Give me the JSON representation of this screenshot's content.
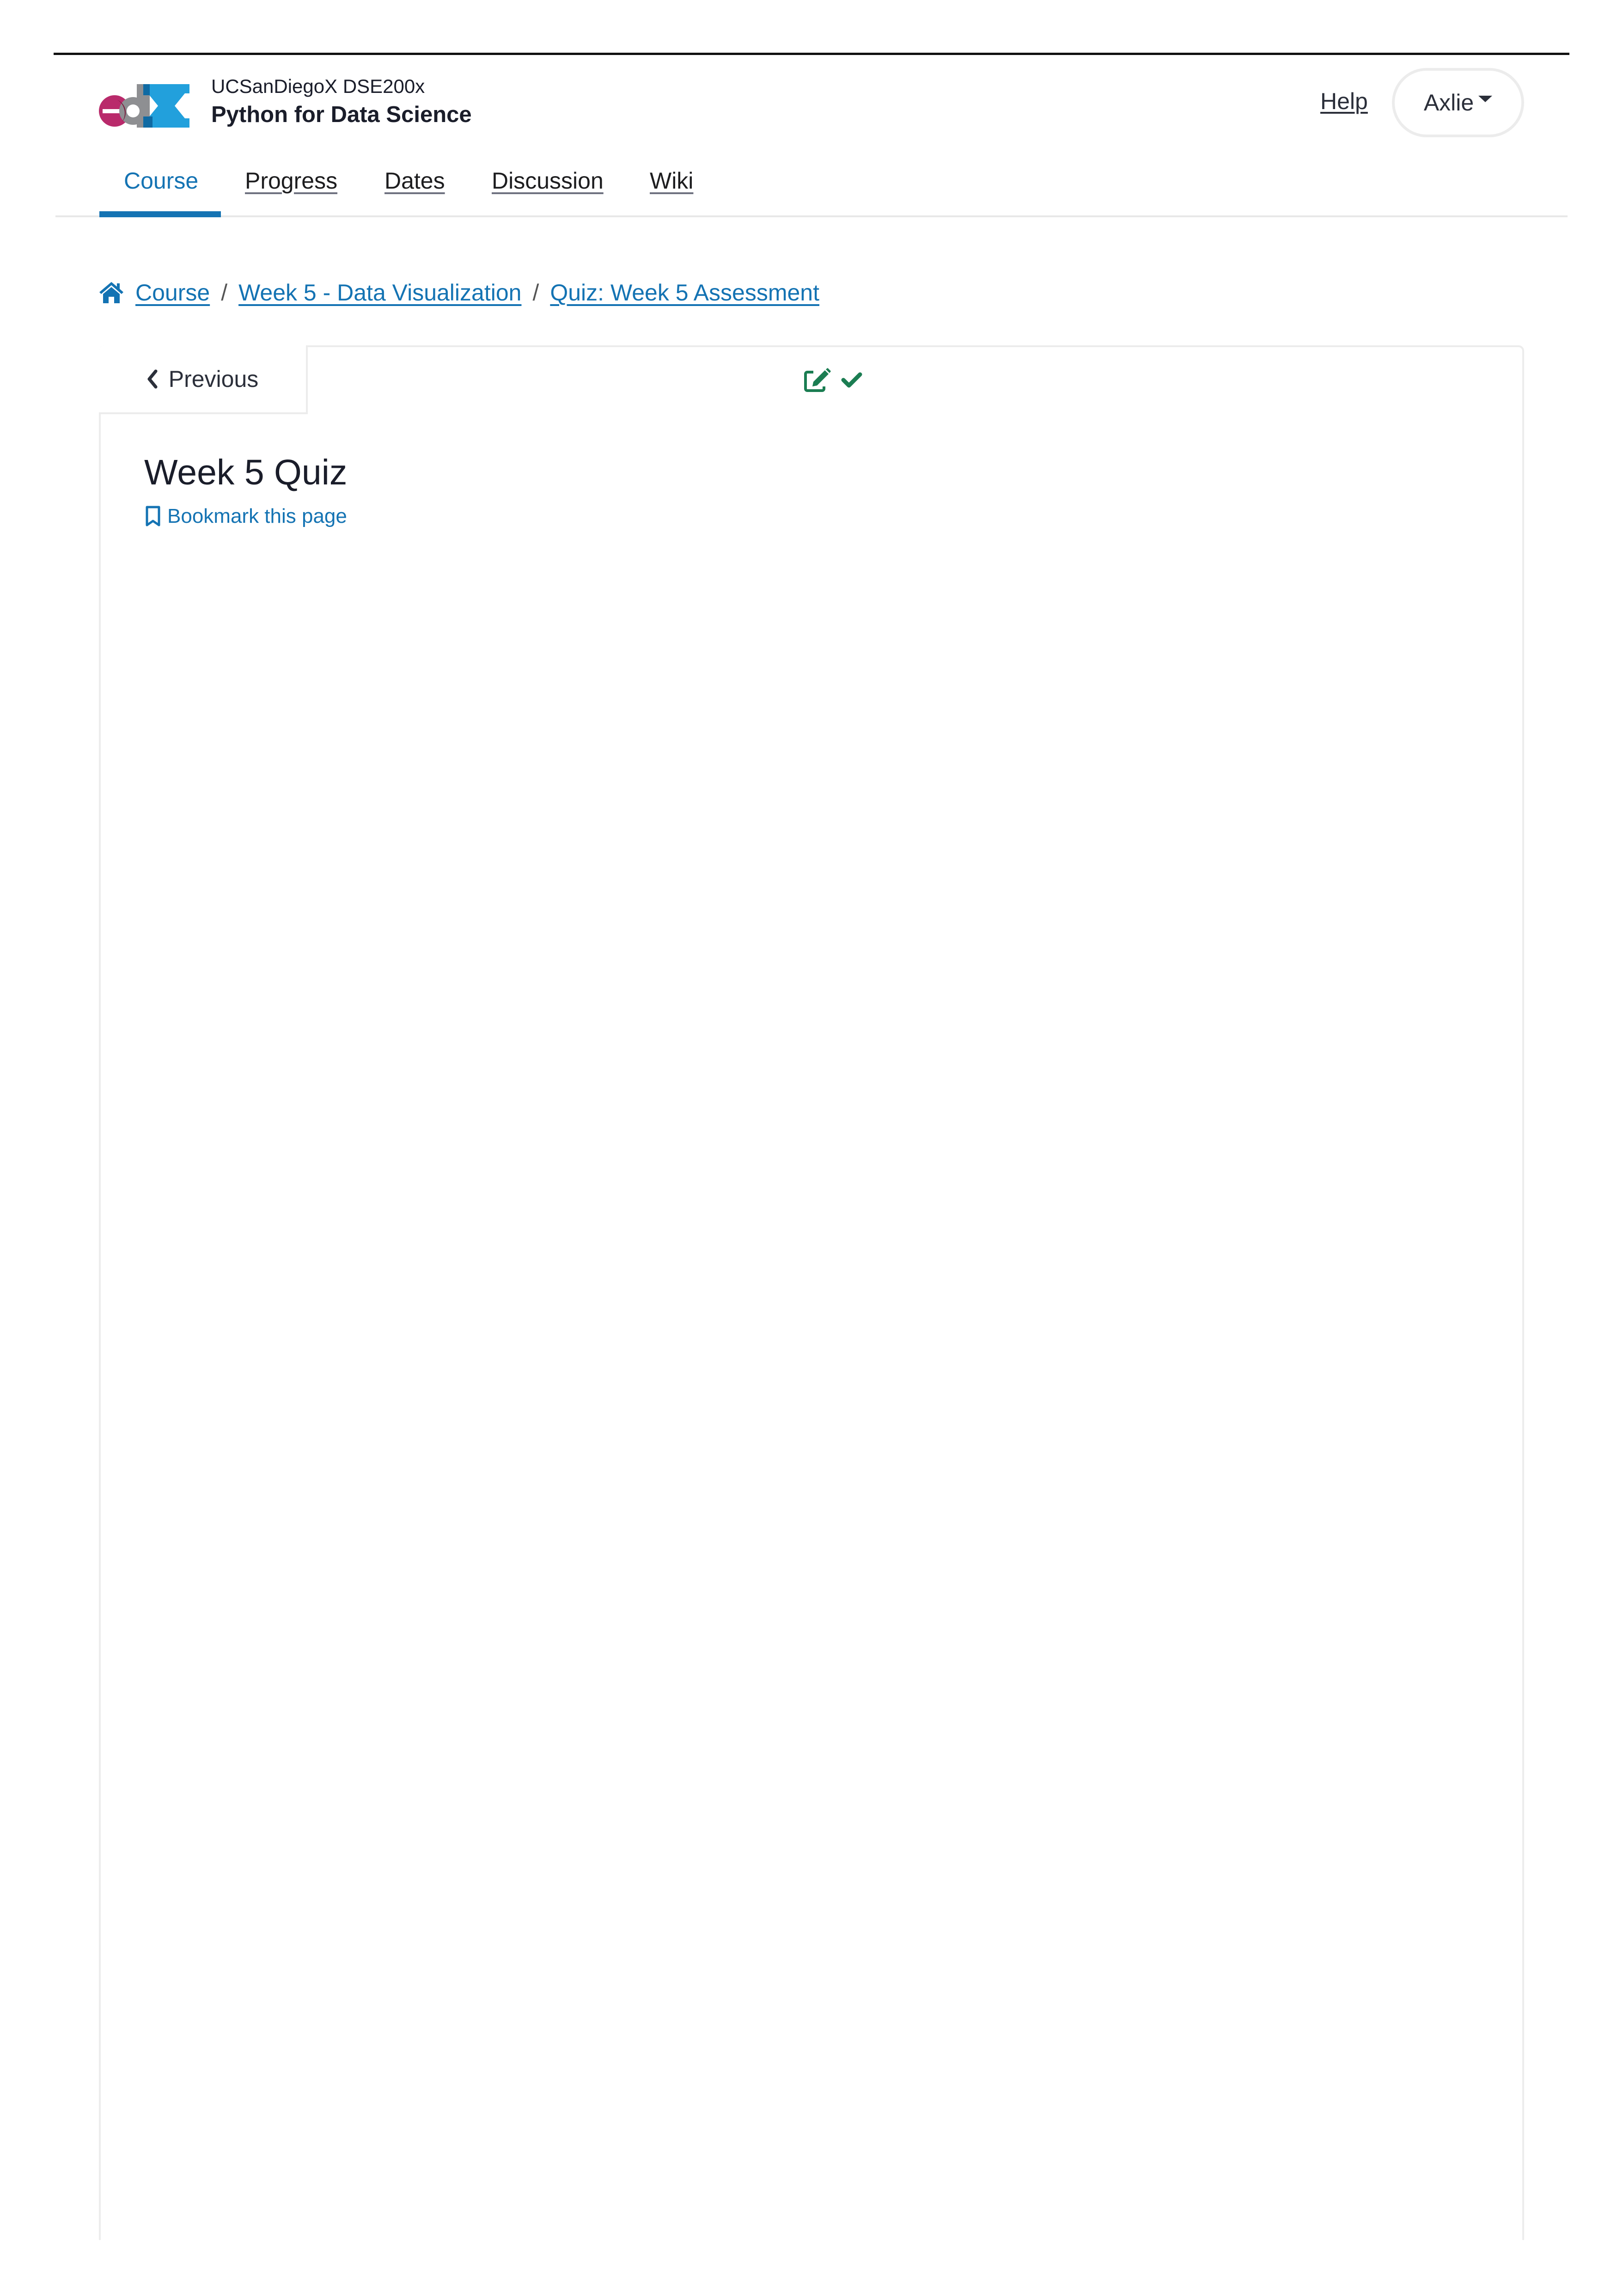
{
  "header": {
    "logo_alt": "edX",
    "course_org": "UCSanDiegoX DSE200x",
    "course_title": "Python for Data Science",
    "help_label": "Help",
    "user_name": "Axlie"
  },
  "nav": {
    "tabs": [
      {
        "label": "Course",
        "active": true
      },
      {
        "label": "Progress",
        "active": false
      },
      {
        "label": "Dates",
        "active": false
      },
      {
        "label": "Discussion",
        "active": false
      },
      {
        "label": "Wiki",
        "active": false
      }
    ]
  },
  "breadcrumb": {
    "items": [
      {
        "label": "Course",
        "icon": "home-icon"
      },
      {
        "label": "Week 5 - Data Visualization"
      },
      {
        "label": "Quiz: Week 5 Assessment"
      }
    ],
    "separator": "/"
  },
  "sequence": {
    "previous_label": "Previous",
    "unit_status_icons": [
      "edit-icon",
      "check-icon"
    ]
  },
  "unit": {
    "title": "Week 5 Quiz",
    "bookmark_label": "Bookmark this page"
  },
  "colors": {
    "brand_blue": "#1473b3",
    "success_green": "#1b7d52",
    "logo_magenta": "#b92a6b",
    "logo_gray": "#8e8f92",
    "logo_blue": "#22a0dc"
  }
}
